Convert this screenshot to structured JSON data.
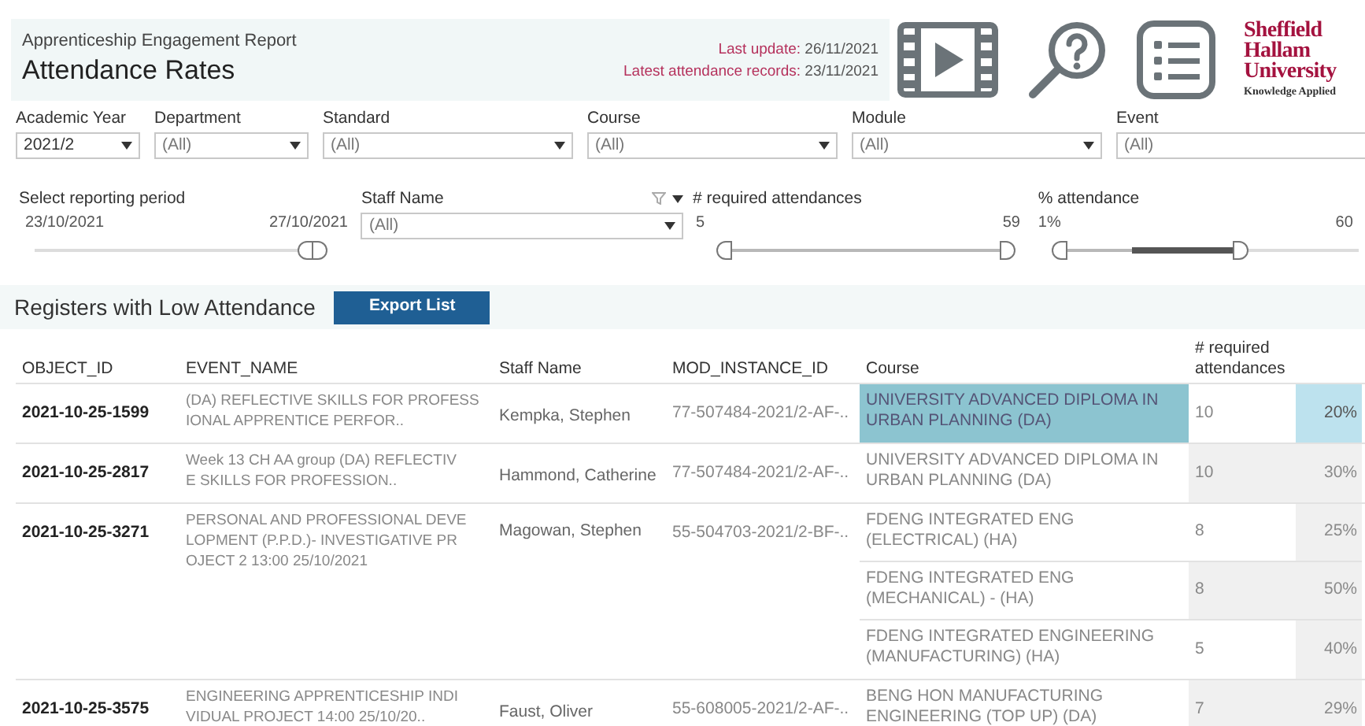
{
  "header": {
    "subtitle": "Apprenticeship Engagement Report",
    "title": "Attendance Rates",
    "last_update_label": "Last update:",
    "last_update": "26/11/2021",
    "latest_records_label": "Latest attendance records:",
    "latest_records": "23/11/2021"
  },
  "logo": {
    "lines": [
      "Sheffield",
      "Hallam",
      "University"
    ],
    "tagline": "Knowledge Applied"
  },
  "filters": [
    {
      "label": "Academic Year",
      "value": "2021/2"
    },
    {
      "label": "Department",
      "value": "(All)"
    },
    {
      "label": "Standard",
      "value": "(All)"
    },
    {
      "label": "Course",
      "value": "(All)"
    },
    {
      "label": "Module",
      "value": "(All)"
    },
    {
      "label": "Event",
      "value": "(All)"
    }
  ],
  "reporting_period": {
    "label": "Select reporting period",
    "start": "23/10/2021",
    "end": "27/10/2021"
  },
  "staff_filter": {
    "label": "Staff Name",
    "value": "(All)"
  },
  "range_sliders": [
    {
      "label": "# required attendances",
      "min": "5",
      "max": "59"
    },
    {
      "label": "% attendance",
      "min": "1%",
      "max": "60"
    }
  ],
  "section": {
    "title": "Registers with Low Attendance",
    "button": "Export List"
  },
  "table": {
    "columns": [
      "OBJECT_ID",
      "EVENT_NAME",
      "Staff Name",
      "MOD_INSTANCE_ID",
      "Course",
      "# required attendances"
    ],
    "rows": [
      {
        "object_id": "2021-10-25-1599",
        "event_name_lines": [
          "(DA) REFLECTIVE SKILLS FOR PROFESS",
          "IONAL APPRENTICE PERFOR.."
        ],
        "staff_name": "Kempka, Stephen",
        "mod_instance_id": "77-507484-2021/2-AF-..",
        "courses": [
          {
            "course": "UNIVERSITY ADVANCED DIPLOMA IN URBAN PLANNING (DA)",
            "required": "10",
            "attendance": "20%",
            "selected": true
          }
        ]
      },
      {
        "object_id": "2021-10-25-2817",
        "event_name_lines": [
          "Week 13 CH AA group (DA) REFLECTIV",
          "E SKILLS FOR PROFESSION.."
        ],
        "staff_name": "Hammond, Catherine",
        "mod_instance_id": "77-507484-2021/2-AF-..",
        "courses": [
          {
            "course": "UNIVERSITY ADVANCED DIPLOMA IN URBAN PLANNING (DA)",
            "required": "10",
            "attendance": "30%",
            "selected": false
          }
        ]
      },
      {
        "object_id": "2021-10-25-3271",
        "event_name_lines": [
          "PERSONAL AND PROFESSIONAL DEVE",
          "LOPMENT (P.P.D.)- INVESTIGATIVE PR",
          "OJECT 2 13:00 25/10/2021"
        ],
        "staff_name": "Magowan, Stephen",
        "mod_instance_id": "55-504703-2021/2-BF-..",
        "courses": [
          {
            "course": "FDENG INTEGRATED ENG (ELECTRICAL) (HA)",
            "required": "8",
            "attendance": "25%",
            "selected": false
          },
          {
            "course": "FDENG INTEGRATED ENG (MECHANICAL) - (HA)",
            "required": "8",
            "attendance": "50%",
            "selected": false
          },
          {
            "course": "FDENG INTEGRATED ENGINEERING (MANUFACTURING) (HA)",
            "required": "5",
            "attendance": "40%",
            "selected": false
          }
        ]
      },
      {
        "object_id": "2021-10-25-3575",
        "event_name_lines": [
          "ENGINEERING APPRENTICESHIP INDI",
          "VIDUAL PROJECT 14:00 25/10/20.."
        ],
        "staff_name": "Faust, Oliver",
        "mod_instance_id": "55-608005-2021/2-AF-..",
        "courses": [
          {
            "course": "BENG HON MANUFACTURING ENGINEERING (TOP UP) (DA)",
            "required": "7",
            "attendance": "29%",
            "selected": false
          }
        ]
      }
    ]
  }
}
